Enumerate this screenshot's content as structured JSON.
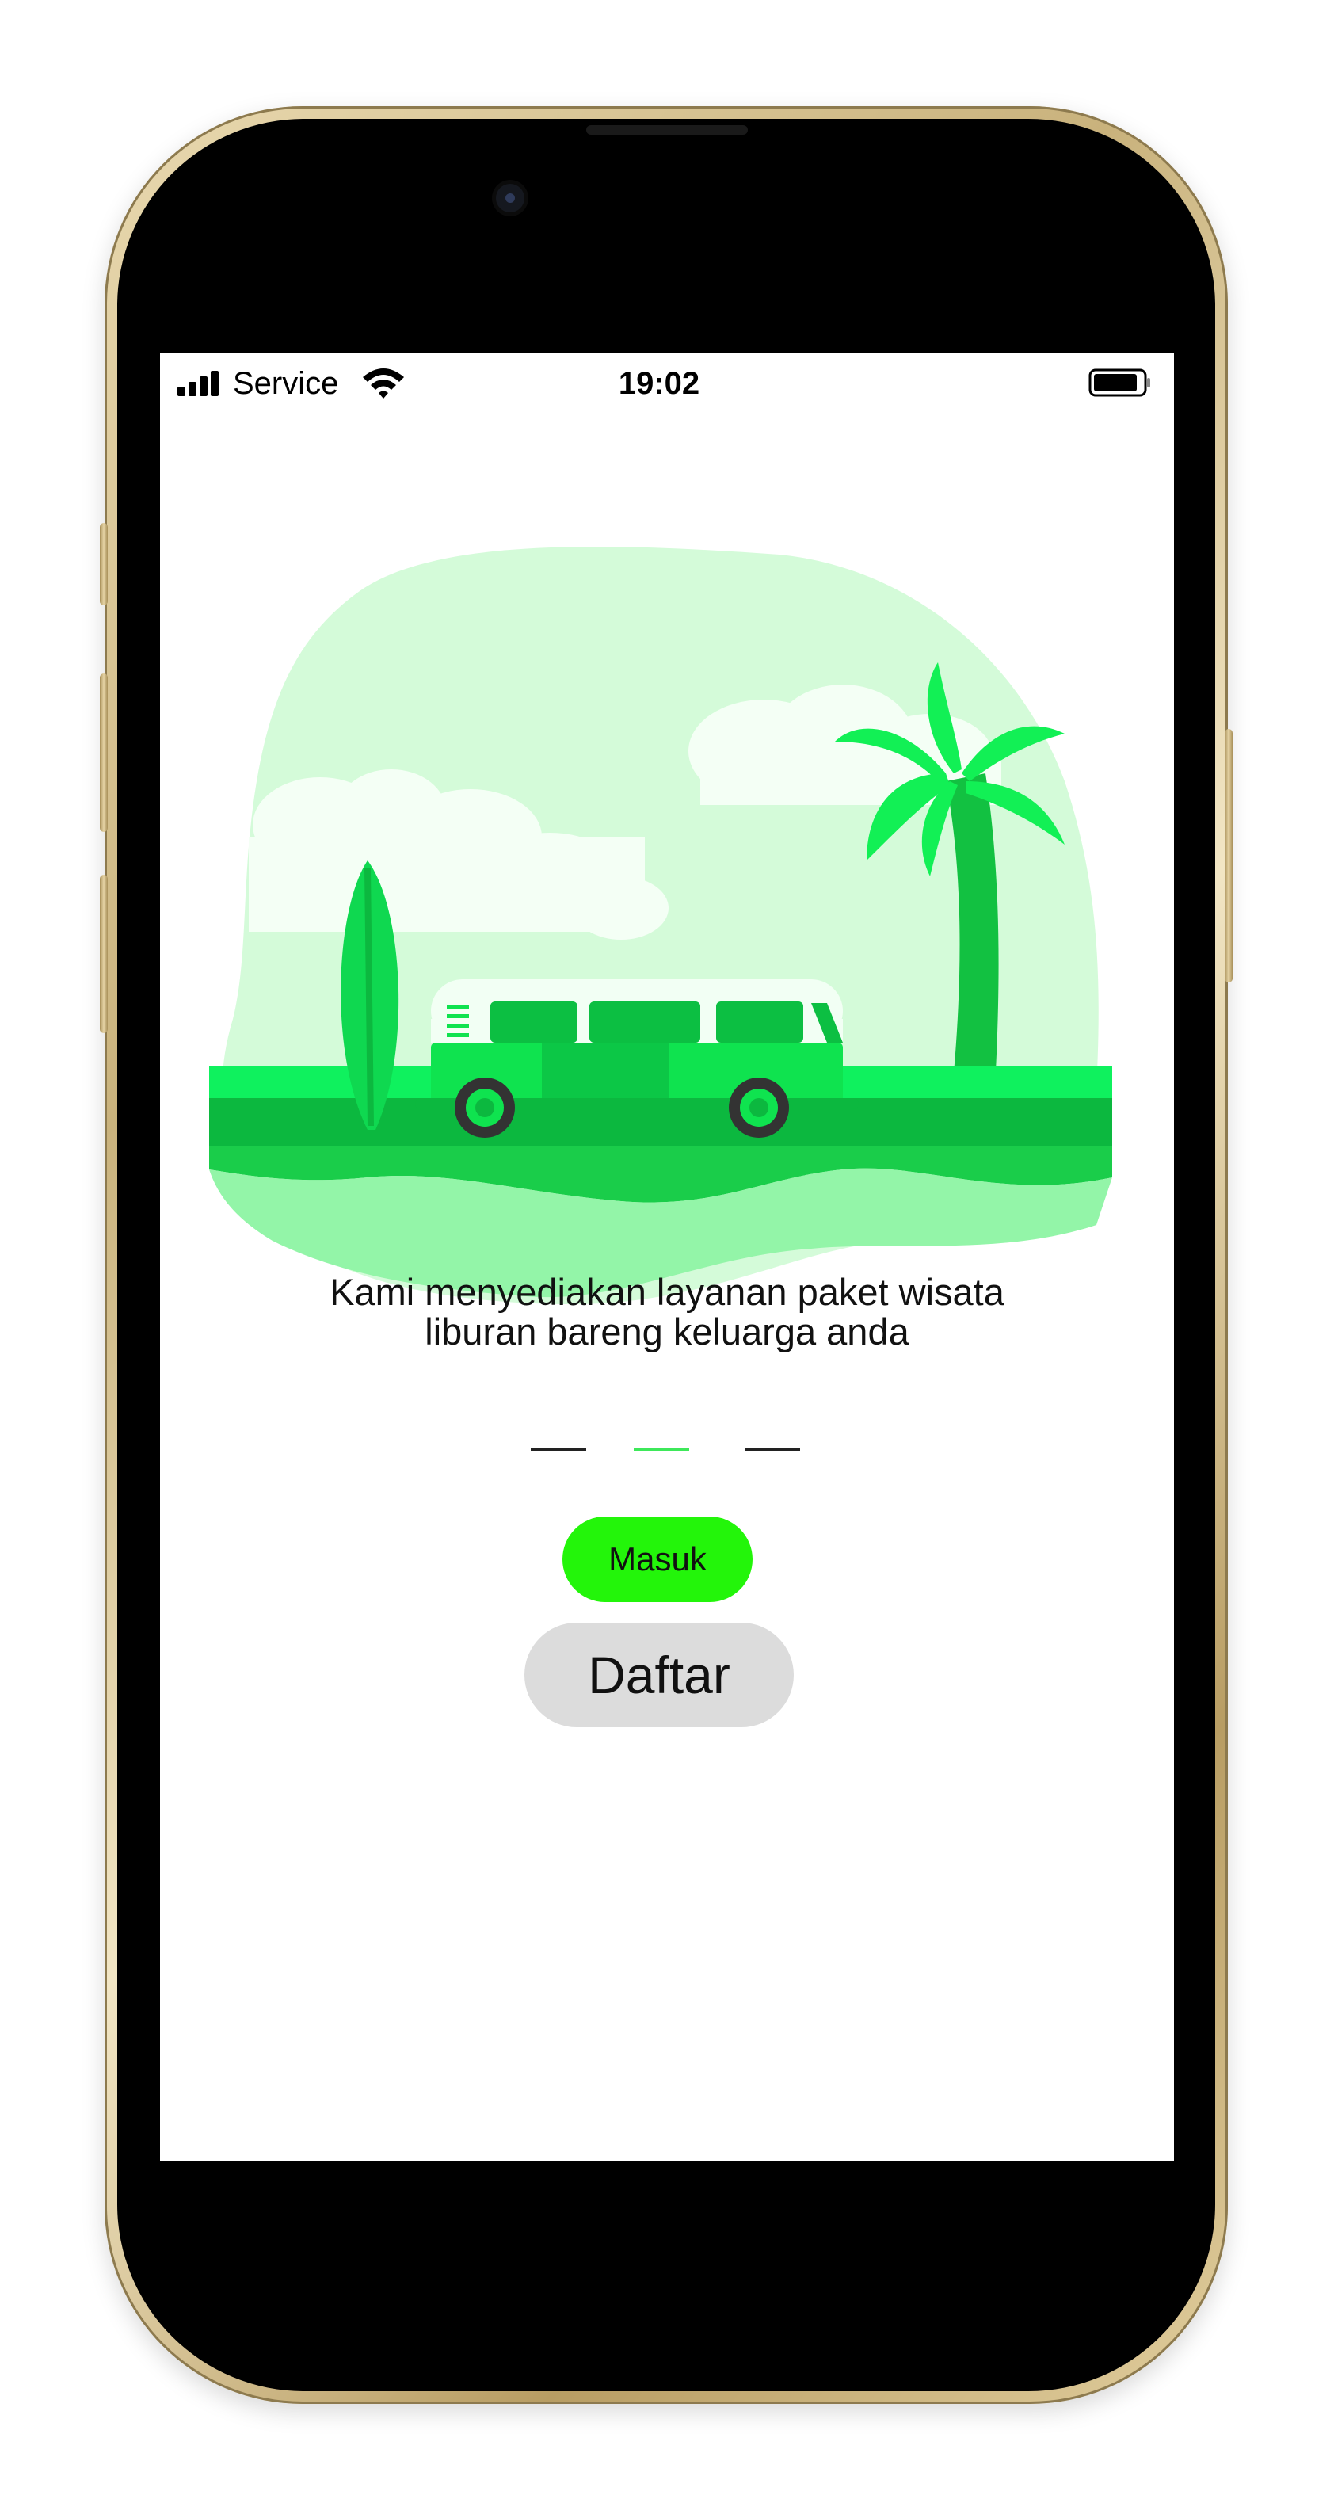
{
  "status_bar": {
    "carrier": "Service",
    "time": "19:02",
    "signal_icon": "cellular-signal-icon",
    "wifi_icon": "wifi-icon",
    "battery_icon": "battery-icon"
  },
  "onboarding": {
    "illustration": "travel-van-beach-illustration",
    "tagline_line1": "Kami menyediakan layanan paket wisata",
    "tagline_line2": "liburan bareng keluarga anda",
    "pages": 3,
    "active_page": 2
  },
  "actions": {
    "login_label": "Masuk",
    "register_label": "Daftar"
  },
  "colors": {
    "accent_green": "#23f50a",
    "secondary_button": "#dcdcdc",
    "indicator_active": "#3ee85a",
    "indicator_inactive": "#222222"
  }
}
